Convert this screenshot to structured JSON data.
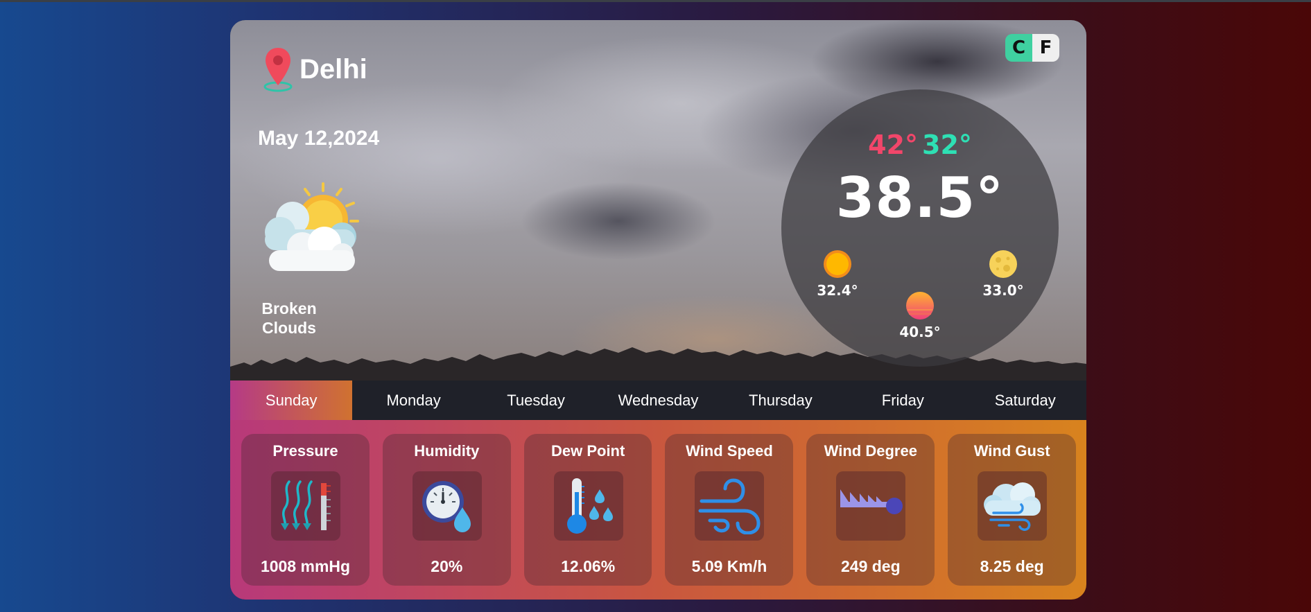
{
  "location": {
    "city": "Delhi",
    "icon": "map-pin-icon"
  },
  "date": "May 12,2024",
  "condition": {
    "text": "Broken Clouds",
    "icon": "sun-behind-clouds-icon"
  },
  "units": {
    "celsius": "C",
    "fahrenheit": "F"
  },
  "temperature": {
    "high": "42°",
    "low": "32°",
    "current": "38.5°",
    "sun_value": "32.4°",
    "sunset_value": "40.5°",
    "moon_value": "33.0°"
  },
  "days": [
    "Sunday",
    "Monday",
    "Tuesday",
    "Wednesday",
    "Thursday",
    "Friday",
    "Saturday"
  ],
  "active_day": "Sunday",
  "stats": [
    {
      "title": "Pressure",
      "value": "1008 mmHg",
      "icon": "pressure-icon"
    },
    {
      "title": "Humidity",
      "value": "20%",
      "icon": "humidity-gauge-icon"
    },
    {
      "title": "Dew Point",
      "value": "12.06%",
      "icon": "thermometer-droplets-icon"
    },
    {
      "title": "Wind Speed",
      "value": "5.09 Km/h",
      "icon": "wind-icon"
    },
    {
      "title": "Wind Degree",
      "value": "249 deg",
      "icon": "wind-direction-icon"
    },
    {
      "title": "Wind Gust",
      "value": "8.25 deg",
      "icon": "cloud-wind-icon"
    }
  ],
  "colors": {
    "high_temp": "#f2466a",
    "low_temp": "#2ee0b4",
    "celsius_toggle": "#3fd0a0",
    "active_day_gradient": [
      "#b53a86",
      "#d07230"
    ],
    "stats_gradient": [
      "#b8397a",
      "#d8831e"
    ]
  }
}
